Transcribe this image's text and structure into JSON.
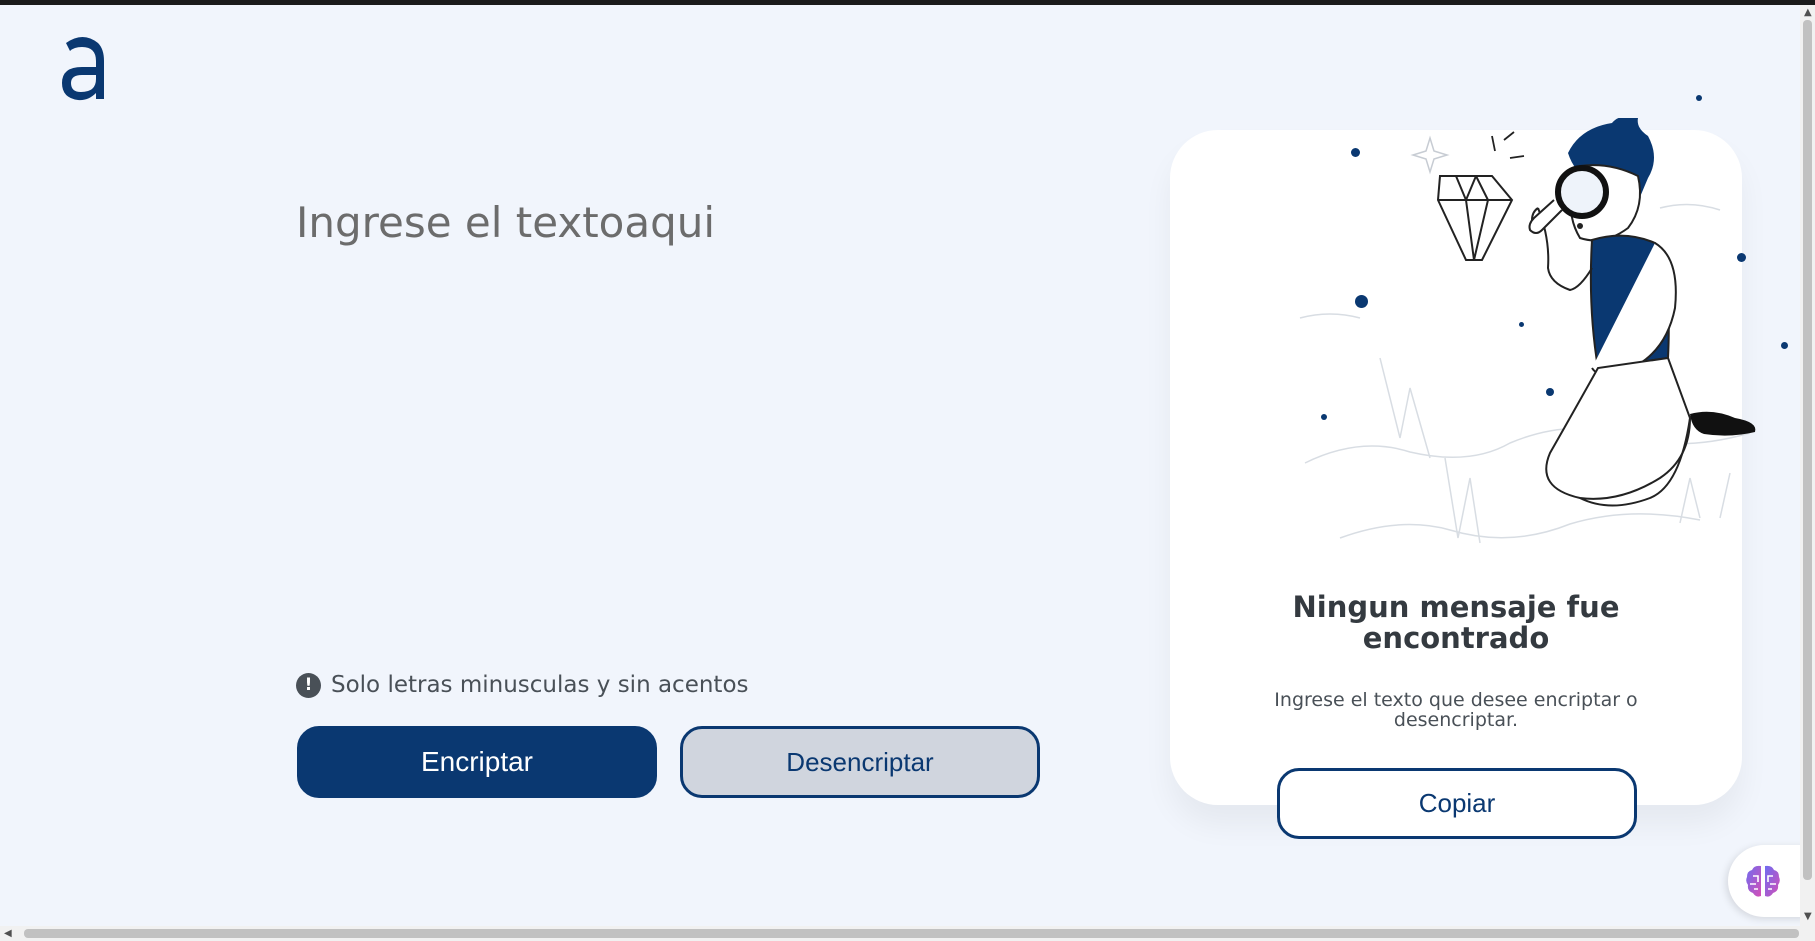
{
  "logo": {
    "letter": "a",
    "icon": "alura-logo-icon"
  },
  "input": {
    "placeholder": "Ingrese el textoaqui",
    "value": ""
  },
  "hint": {
    "icon": "exclamation-circle-icon",
    "text": "Solo letras minusculas y sin acentos"
  },
  "buttons": {
    "encrypt": "Encriptar",
    "decrypt": "Desencriptar",
    "copy": "Copiar"
  },
  "output": {
    "illustration": "boy-with-magnifying-glass-illustration",
    "title": "Ningun mensaje fue encontrado",
    "subtitle": "Ingrese el texto que desee encriptar o desencriptar."
  },
  "extension": {
    "icon": "brain-icon"
  },
  "colors": {
    "primary": "#0a3871",
    "background": "#f1f5fc",
    "card": "#ffffff",
    "secondary_button": "#d0d5de"
  }
}
